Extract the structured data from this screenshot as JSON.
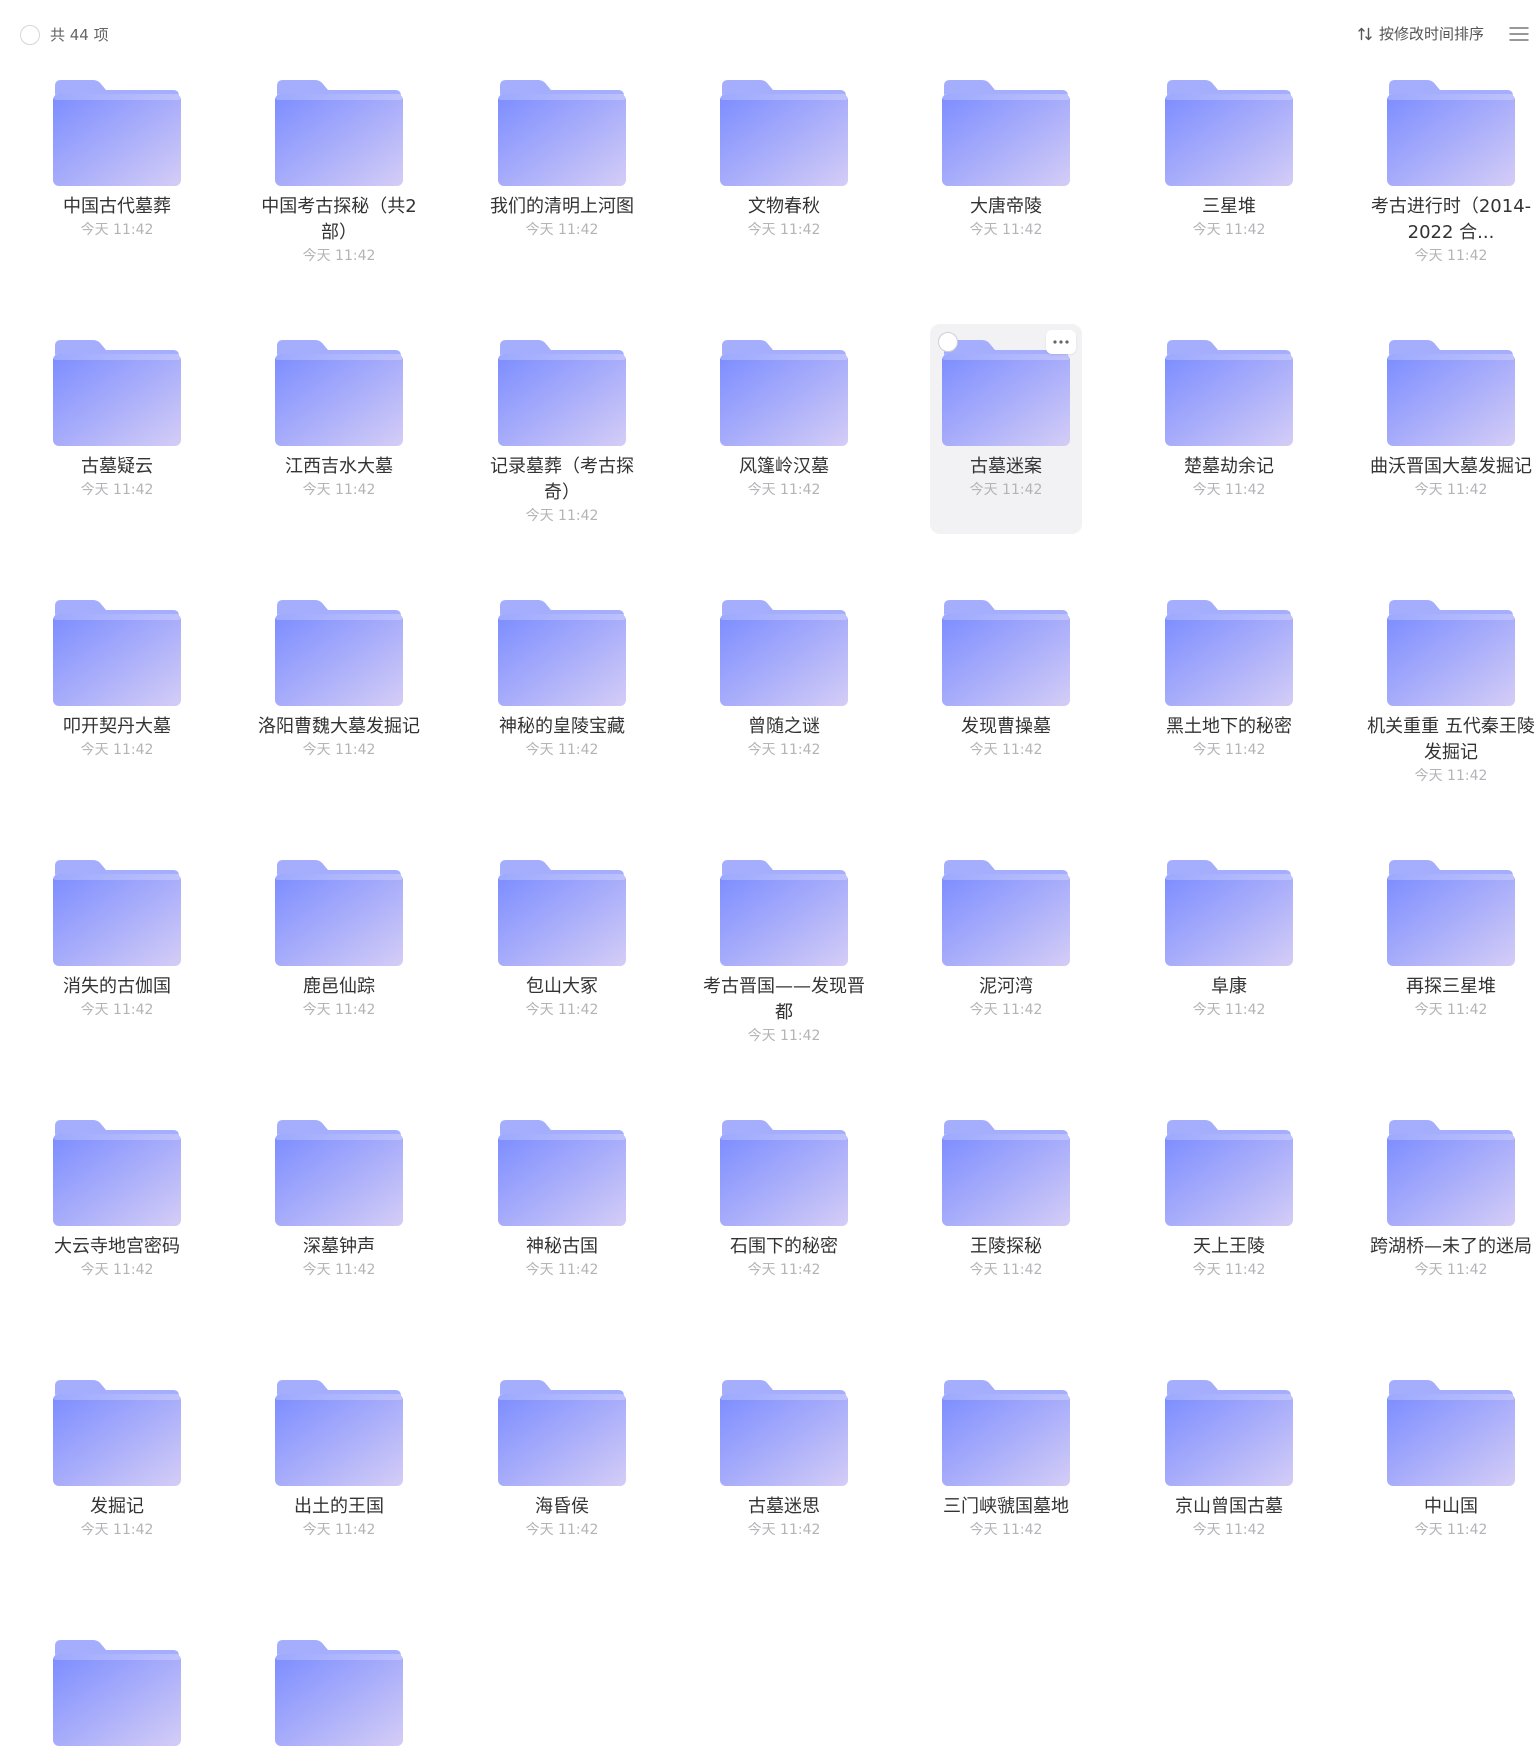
{
  "header": {
    "item_count": "共 44 项",
    "sort_label": "按修改时间排序"
  },
  "icons": {
    "folder": "folder-icon",
    "sort": "sort-arrows-icon",
    "menu": "list-menu-icon",
    "more": "more-horizontal-icon",
    "checkbox": "circle-checkbox-icon"
  },
  "colors": {
    "folder_front_start": "#7b8cff",
    "folder_front_end": "#d4cdf6",
    "folder_back": "#a4aefc",
    "hover_bg": "#f2f2f4",
    "date_text": "#b4b4b8"
  },
  "hovered_index": 11,
  "folders": [
    {
      "name": "中国古代墓葬",
      "date": "今天 11:42"
    },
    {
      "name": "中国考古探秘（共2部）",
      "date": "今天 11:42"
    },
    {
      "name": "我们的清明上河图",
      "date": "今天 11:42"
    },
    {
      "name": "文物春秋",
      "date": "今天 11:42"
    },
    {
      "name": "大唐帝陵",
      "date": "今天 11:42"
    },
    {
      "name": "三星堆",
      "date": "今天 11:42"
    },
    {
      "name": "考古进行时（2014-2022 合...",
      "date": "今天 11:42"
    },
    {
      "name": "古墓疑云",
      "date": "今天 11:42"
    },
    {
      "name": "江西吉水大墓",
      "date": "今天 11:42"
    },
    {
      "name": "记录墓葬（考古探奇）",
      "date": "今天 11:42"
    },
    {
      "name": "风篷岭汉墓",
      "date": "今天 11:42"
    },
    {
      "name": "古墓迷案",
      "date": "今天 11:42"
    },
    {
      "name": "楚墓劫余记",
      "date": "今天 11:42"
    },
    {
      "name": "曲沃晋国大墓发掘记",
      "date": "今天 11:42"
    },
    {
      "name": "叩开契丹大墓",
      "date": "今天 11:42"
    },
    {
      "name": "洛阳曹魏大墓发掘记",
      "date": "今天 11:42"
    },
    {
      "name": "神秘的皇陵宝藏",
      "date": "今天 11:42"
    },
    {
      "name": "曾随之谜",
      "date": "今天 11:42"
    },
    {
      "name": "发现曹操墓",
      "date": "今天 11:42"
    },
    {
      "name": "黑土地下的秘密",
      "date": "今天 11:42"
    },
    {
      "name": "机关重重 五代秦王陵发掘记",
      "date": "今天 11:42"
    },
    {
      "name": "消失的古伽国",
      "date": "今天 11:42"
    },
    {
      "name": "鹿邑仙踪",
      "date": "今天 11:42"
    },
    {
      "name": "包山大冢",
      "date": "今天 11:42"
    },
    {
      "name": "考古晋国——发现晋都",
      "date": "今天 11:42"
    },
    {
      "name": "泥河湾",
      "date": "今天 11:42"
    },
    {
      "name": "阜康",
      "date": "今天 11:42"
    },
    {
      "name": "再探三星堆",
      "date": "今天 11:42"
    },
    {
      "name": "大云寺地宫密码",
      "date": "今天 11:42"
    },
    {
      "name": "深墓钟声",
      "date": "今天 11:42"
    },
    {
      "name": "神秘古国",
      "date": "今天 11:42"
    },
    {
      "name": "石围下的秘密",
      "date": "今天 11:42"
    },
    {
      "name": "王陵探秘",
      "date": "今天 11:42"
    },
    {
      "name": "天上王陵",
      "date": "今天 11:42"
    },
    {
      "name": "跨湖桥—未了的迷局",
      "date": "今天 11:42"
    },
    {
      "name": "发掘记",
      "date": "今天 11:42"
    },
    {
      "name": "出土的王国",
      "date": "今天 11:42"
    },
    {
      "name": "海昏侯",
      "date": "今天 11:42"
    },
    {
      "name": "古墓迷思",
      "date": "今天 11:42"
    },
    {
      "name": "三门峡虢国墓地",
      "date": "今天 11:42"
    },
    {
      "name": "京山曾国古墓",
      "date": "今天 11:42"
    },
    {
      "name": "中山国",
      "date": "今天 11:42"
    },
    {
      "name": "",
      "date": ""
    },
    {
      "name": "",
      "date": ""
    }
  ]
}
